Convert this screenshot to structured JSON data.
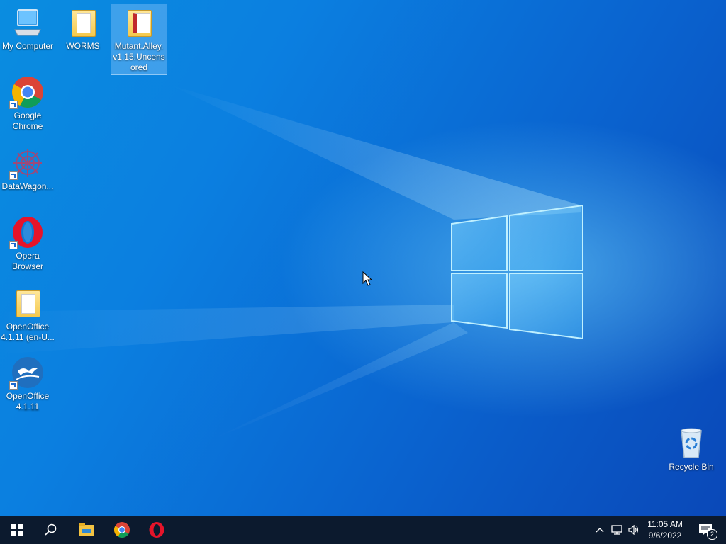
{
  "desktop": {
    "icons": [
      {
        "label": "My Computer",
        "icon": "computer-icon",
        "shortcut": false
      },
      {
        "label": "WORMS",
        "icon": "folder-icon",
        "shortcut": false
      },
      {
        "label": "Mutant.Alley.v1.15.Uncensored",
        "label_lines": [
          "Mutant.Alley.",
          "v1.15.Uncens",
          "ored"
        ],
        "icon": "folder-icon",
        "shortcut": false,
        "selected": true
      },
      {
        "label": "Google Chrome",
        "label_lines": [
          "Google",
          "Chrome"
        ],
        "icon": "chrome-icon",
        "shortcut": true
      },
      {
        "label": "DataWagon...",
        "icon": "datawagon-icon",
        "shortcut": true
      },
      {
        "label": "Opera Browser",
        "label_lines": [
          "Opera",
          "Browser"
        ],
        "icon": "opera-icon",
        "shortcut": true
      },
      {
        "label": "OpenOffice 4.1.11 (en-U...",
        "label_lines": [
          "OpenOffice",
          "4.1.11 (en-U..."
        ],
        "icon": "folder-icon",
        "shortcut": false
      },
      {
        "label": "OpenOffice 4.1.11",
        "label_lines": [
          "OpenOffice",
          "4.1.11"
        ],
        "icon": "openoffice-icon",
        "shortcut": true
      },
      {
        "label": "Recycle Bin",
        "icon": "recycle-bin-icon",
        "shortcut": false
      }
    ]
  },
  "taskbar": {
    "pinned": [
      {
        "name": "Start",
        "icon": "windows-start-icon"
      },
      {
        "name": "Search",
        "icon": "search-icon"
      },
      {
        "name": "File Explorer",
        "icon": "file-explorer-icon"
      },
      {
        "name": "Google Chrome",
        "icon": "chrome-icon"
      },
      {
        "name": "Opera",
        "icon": "opera-icon"
      }
    ],
    "tray": {
      "time": "11:05 AM",
      "date": "9/6/2022",
      "notification_count": "2"
    }
  },
  "colors": {
    "taskbar_bg": "#0c1a2e",
    "desktop_accent": "#0a6fd8"
  }
}
